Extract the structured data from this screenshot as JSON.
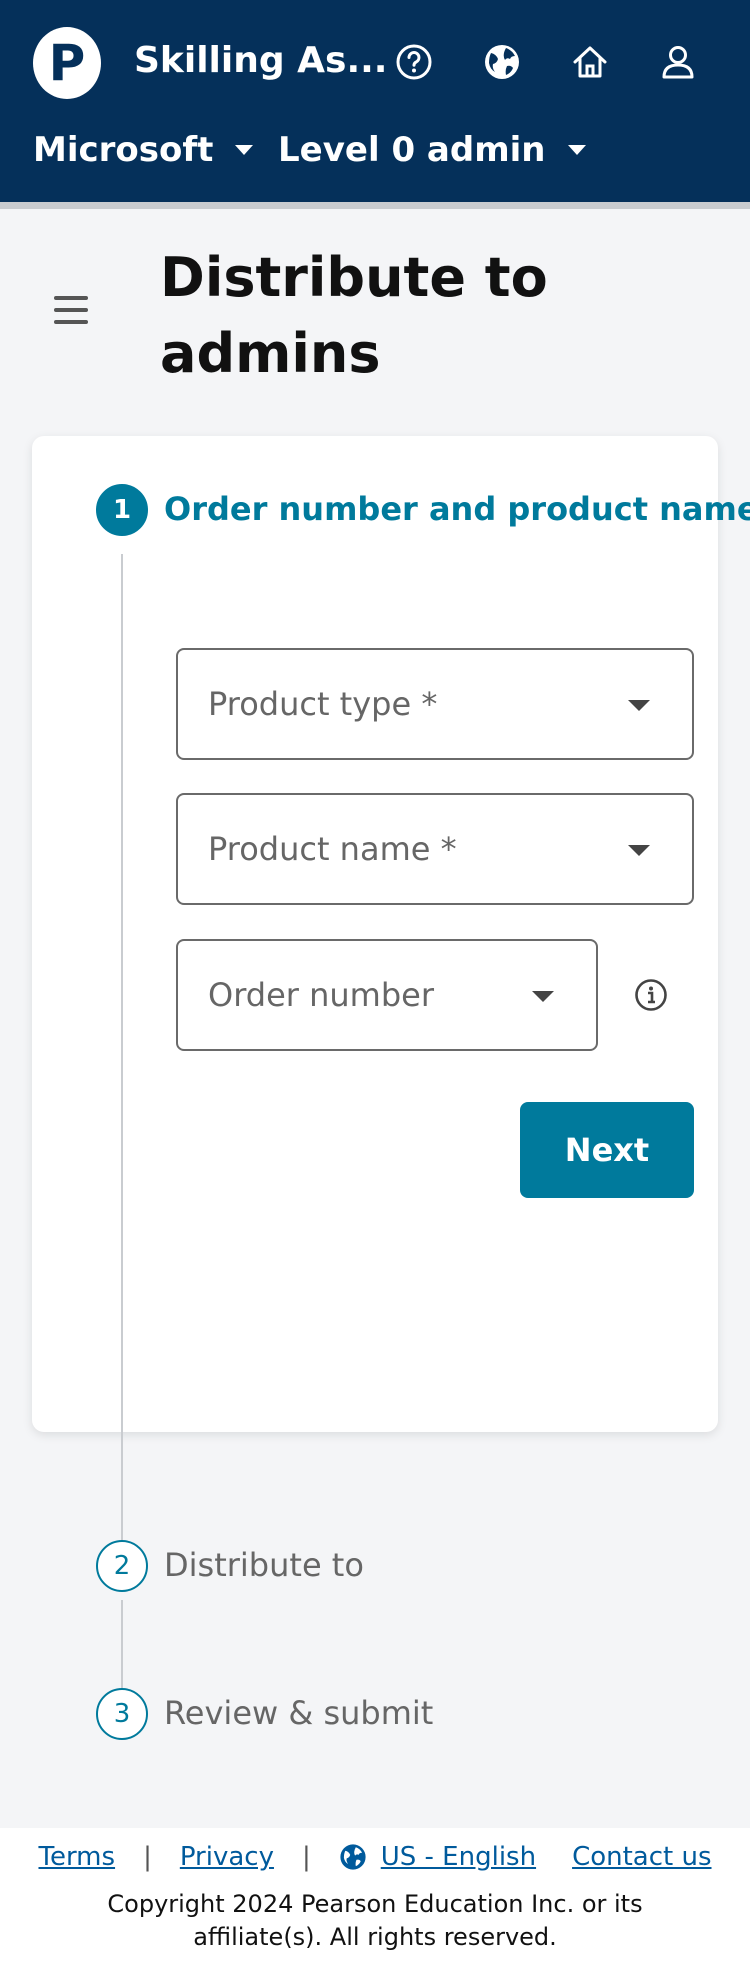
{
  "header": {
    "logo_letter": "P",
    "app_title": "Skilling As...",
    "icons": [
      "help-icon",
      "globe-icon",
      "home-icon",
      "user-icon"
    ],
    "org_dropdown": "Microsoft",
    "role_dropdown": "Level 0 admin"
  },
  "page": {
    "title": "Distribute to admins"
  },
  "stepper": {
    "steps": [
      {
        "number": "1",
        "label": "Order number and product name",
        "state": "active"
      },
      {
        "number": "2",
        "label": "Distribute to",
        "state": "inactive"
      },
      {
        "number": "3",
        "label": "Review & submit",
        "state": "inactive"
      }
    ]
  },
  "form": {
    "product_type": "Product type *",
    "product_name": "Product name *",
    "order_number": "Order number",
    "next_label": "Next"
  },
  "footer": {
    "terms": "Terms",
    "privacy": "Privacy",
    "language": "US - English",
    "contact": "Contact us",
    "copyright": "Copyright 2024 Pearson Education Inc. or its affiliate(s). All rights reserved."
  },
  "colors": {
    "header_bg": "#05305a",
    "accent": "#007a9c",
    "link": "#005a9c",
    "page_bg": "#f4f5f7"
  }
}
